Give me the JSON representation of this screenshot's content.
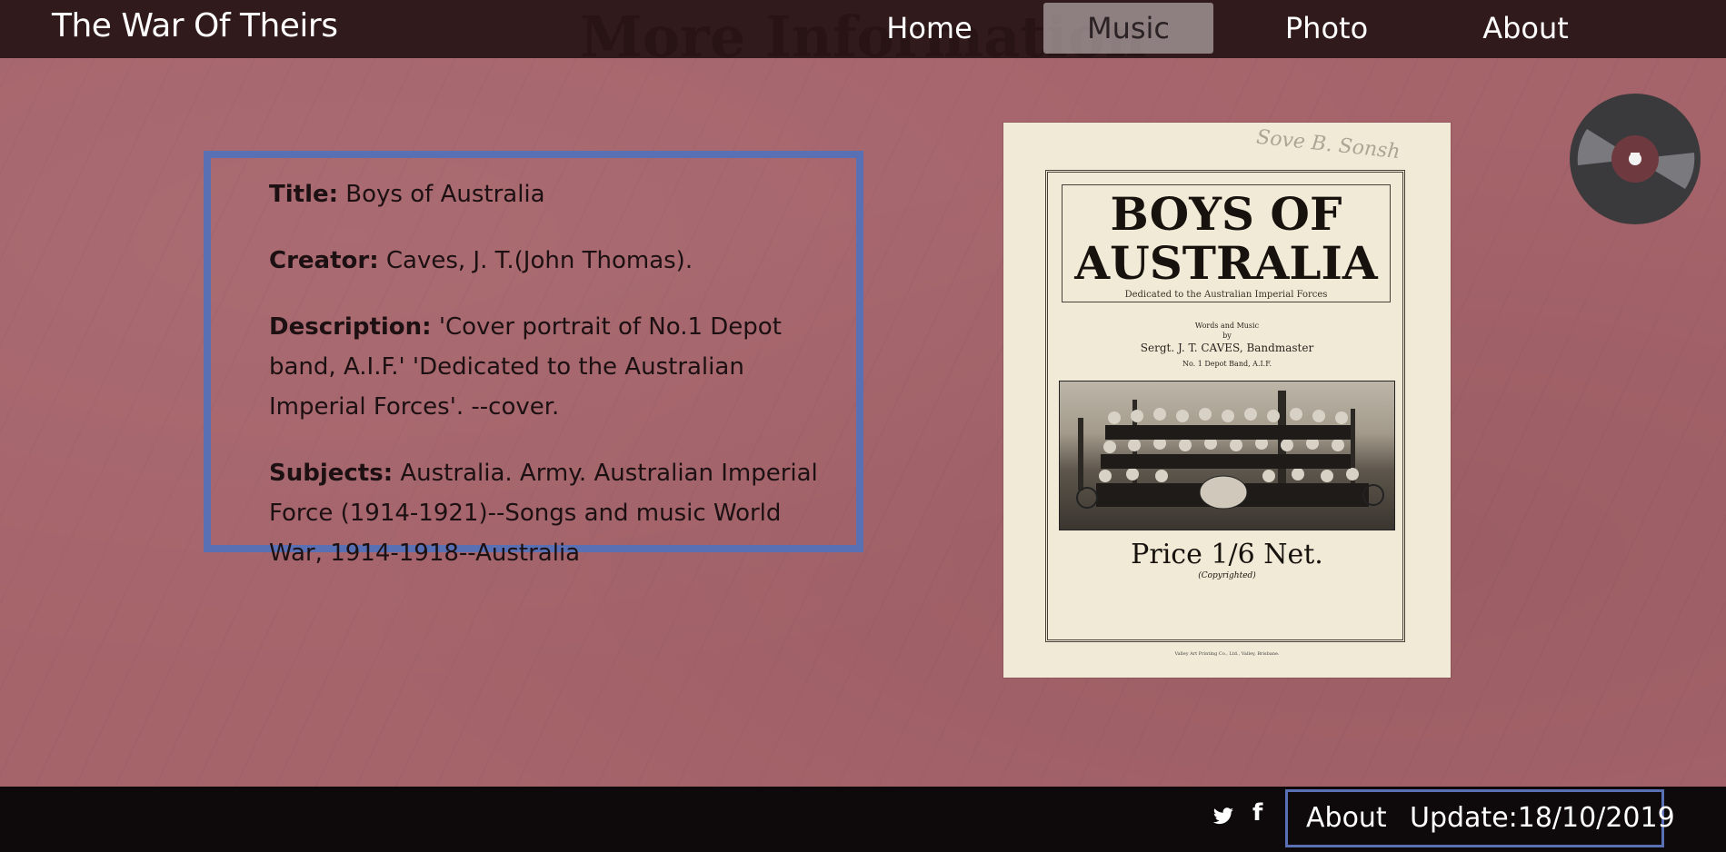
{
  "page": {
    "heading": "More Information"
  },
  "navbar": {
    "brand": "The War Of Theirs",
    "items": [
      {
        "label": "Home",
        "active": false
      },
      {
        "label": "Music",
        "active": true
      },
      {
        "label": "Photo",
        "active": false
      },
      {
        "label": "About",
        "active": false
      }
    ]
  },
  "details": {
    "title_label": "Title:",
    "title_value": "Boys of Australia",
    "creator_label": "Creator:",
    "creator_value": "Caves, J. T.(John Thomas).",
    "description_label": "Description:",
    "description_value": "'Cover portrait of No.1 Depot band, A.I.F.' 'Dedicated to the Australian Imperial Forces'. --cover.",
    "subjects_label": "Subjects:",
    "subjects_value": "Australia. Army. Australian Imperial Force (1914-1921)--Songs and music World War, 1914-1918--Australia"
  },
  "cover_image": {
    "title_line1": "BOYS OF",
    "title_line2": "AUSTRALIA",
    "dedication": "Dedicated to the Australian Imperial Forces",
    "words_line1": "Words and Music",
    "words_line2": "by",
    "author": "Sergt. J. T. CAVES, Bandmaster",
    "band": "No. 1 Depot Band, A.I.F.",
    "price": "Price 1/6 Net.",
    "copyright": "(Copyrighted)",
    "printer": "Valley Art Printing Co., Ltd., Valley, Brisbane.",
    "signature": "Sove B. Sonsh"
  },
  "record_player": {
    "icon": "vinyl-record-icon"
  },
  "footer": {
    "social": [
      {
        "icon": "twitter-icon",
        "glyph": "🐦"
      },
      {
        "icon": "facebook-icon",
        "glyph": "f"
      }
    ],
    "about_label": "About",
    "update_label": "Update:18/10/2019"
  },
  "colors": {
    "background": "#a5636a",
    "navbar": "#281416",
    "accent_border": "#5a70b4",
    "footer": "#0e0a0c"
  }
}
